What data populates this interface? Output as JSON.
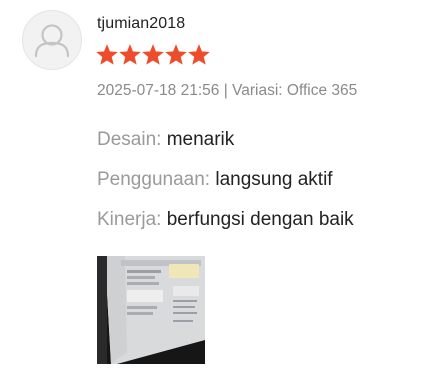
{
  "review": {
    "username": "tjumian2018",
    "rating": 5,
    "max_rating": 5,
    "star_color": "#ee4d2d",
    "datetime": "2025-07-18 21:56",
    "separator": " | ",
    "variation_label": "Variasi:",
    "variation_value": "Office 365",
    "attributes": [
      {
        "key": "Desain:",
        "value": "menarik"
      },
      {
        "key": "Penggunaan:",
        "value": "langsung aktif"
      },
      {
        "key": "Kinerja:",
        "value": "berfungsi dengan baik"
      }
    ],
    "media": {
      "icon": "photo-thumbnail"
    }
  }
}
